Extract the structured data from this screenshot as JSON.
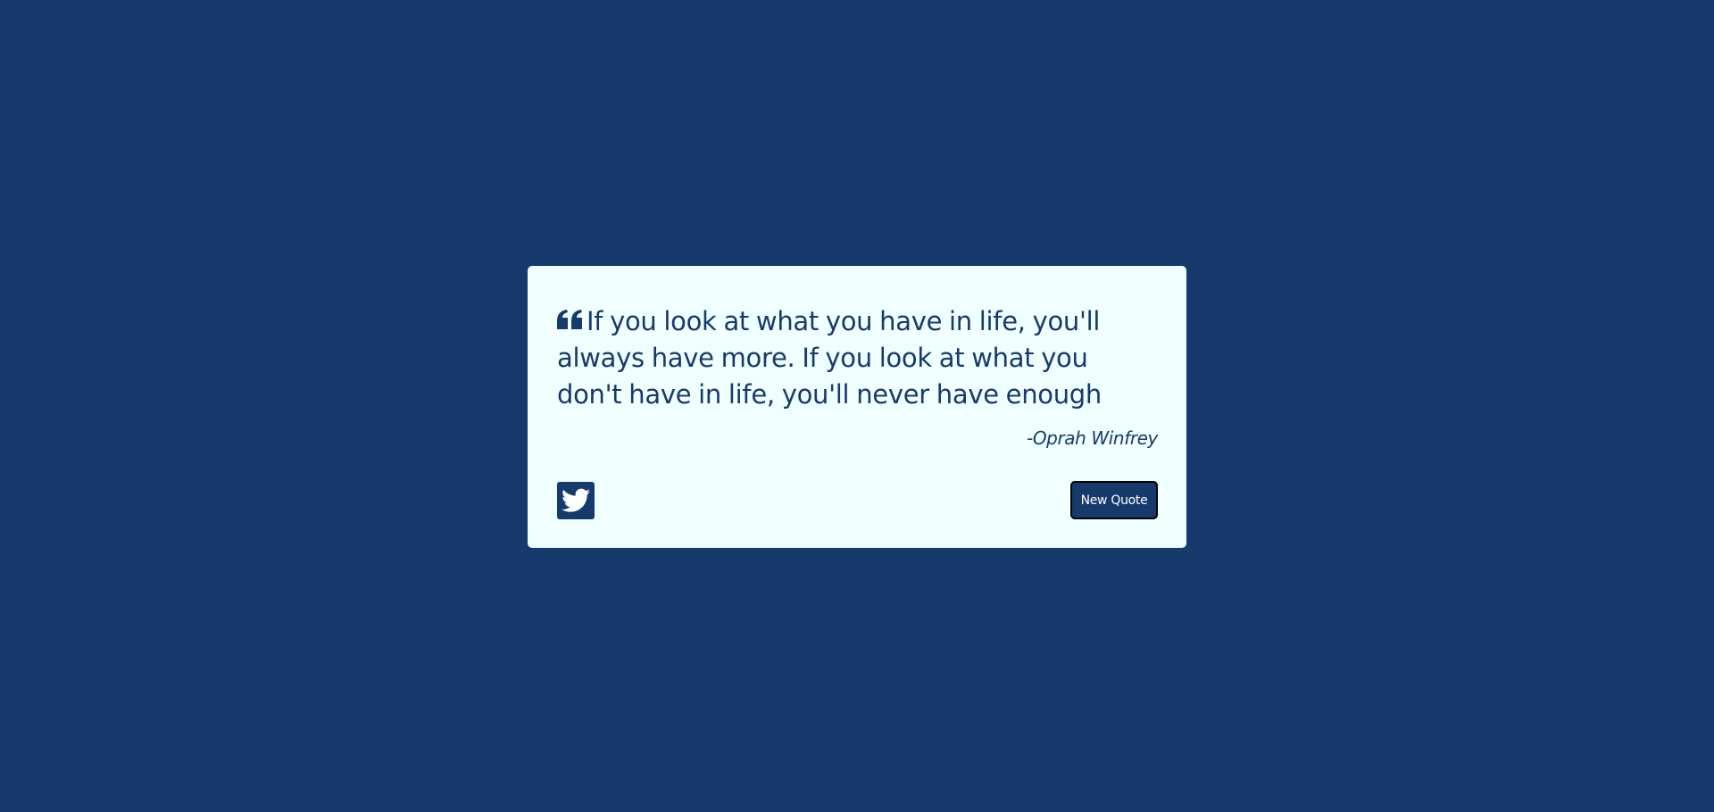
{
  "quote": {
    "text": "If you look at what you have in life, you'll always have more. If you look at what you don't have in life, you'll never have enough",
    "author": "-Oprah Winfrey",
    "icon": "quote-left-icon"
  },
  "actions": {
    "tweet_icon": "twitter-icon",
    "new_quote_label": "New Quote"
  },
  "colors": {
    "background": "#173a6d",
    "card": "#f0ffff",
    "accent": "#173a6d",
    "button_text": "#ffffff"
  }
}
